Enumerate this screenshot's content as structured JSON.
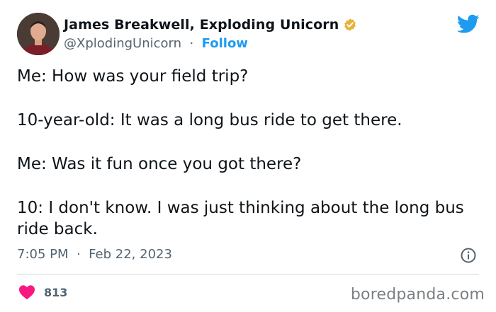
{
  "author": {
    "display_name": "James Breakwell, Exploding Unicorn",
    "handle": "@XplodingUnicorn",
    "separator": "·",
    "follow_label": "Follow",
    "verified_badge_icon": "verified-gold-check-icon",
    "verified_badge_color": "#e8b13b"
  },
  "tweet": {
    "lines": [
      "Me: How was your field trip?",
      "10-year-old: It was a long bus ride to get there.",
      "Me: Was it fun once you got there?",
      "10: I don't know. I was just thinking about the long bus ride back."
    ],
    "time": "7:05 PM",
    "separator": "·",
    "date": "Feb 22, 2023"
  },
  "engagement": {
    "like_count": "813",
    "heart_color": "#f91880"
  },
  "brand": {
    "twitter_icon": "twitter-bird-icon",
    "twitter_color": "#1d9bf0",
    "info_icon": "info-icon"
  },
  "watermark": {
    "text": "boredpanda.com"
  }
}
